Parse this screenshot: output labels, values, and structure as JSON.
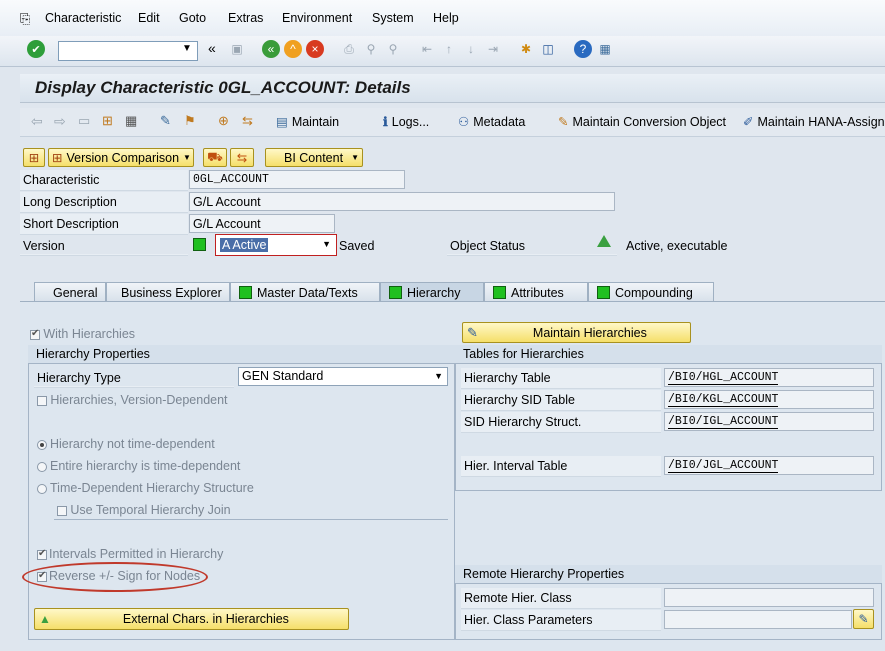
{
  "menu": {
    "items": [
      "Characteristic",
      "Edit",
      "Goto",
      "Extras",
      "Environment",
      "System",
      "Help"
    ]
  },
  "toolbar": {
    "command_field": ""
  },
  "title": "Display Characteristic 0GL_ACCOUNT: Details",
  "app_toolbar": {
    "maintain": "Maintain",
    "logs": "Logs...",
    "metadata": "Metadata",
    "maintain_conversion": "Maintain Conversion Object",
    "maintain_hana": "Maintain HANA-Assignm"
  },
  "header_buttons": {
    "version_comparison": "Version Comparison",
    "bi_content": "BI Content"
  },
  "fields": {
    "characteristic_label": "Characteristic",
    "characteristic_value": "0GL_ACCOUNT",
    "long_desc_label": "Long Description",
    "long_desc_value": "G/L Account",
    "short_desc_label": "Short Description",
    "short_desc_value": "G/L Account",
    "version_label": "Version",
    "version_value": "A Active",
    "version_status": "Saved",
    "object_status_label": "Object Status",
    "object_status_value": "Active, executable"
  },
  "tabs": [
    "General",
    "Business Explorer",
    "Master Data/Texts",
    "Hierarchy",
    "Attributes",
    "Compounding"
  ],
  "hierarchy": {
    "with_hierarchies": "With Hierarchies",
    "maintain_hierarchies": "Maintain Hierarchies",
    "props_title": "Hierarchy Properties",
    "hierarchy_type_label": "Hierarchy Type",
    "hierarchy_type_value": "GEN Standard",
    "version_dependent": "Hierarchies, Version-Dependent",
    "not_time_dependent": "Hierarchy not time-dependent",
    "entire_time_dependent": "Entire hierarchy is time-dependent",
    "time_dep_structure": "Time-Dependent Hierarchy Structure",
    "temporal_join": "Use Temporal Hierarchy Join",
    "intervals_permitted": "Intervals Permitted in Hierarchy",
    "reverse_sign": "Reverse +/- Sign for Nodes",
    "external_chars": "External Chars. in Hierarchies",
    "tables_title": "Tables for Hierarchies",
    "hier_table_label": "Hierarchy Table",
    "hier_table_value": "/BI0/HGL_ACCOUNT",
    "sid_table_label": "Hierarchy SID Table",
    "sid_table_value": "/BI0/KGL_ACCOUNT",
    "sid_struct_label": "SID Hierarchy Struct.",
    "sid_struct_value": "/BI0/IGL_ACCOUNT",
    "interval_table_label": "Hier. Interval Table",
    "interval_table_value": "/BI0/JGL_ACCOUNT",
    "remote_title": "Remote Hierarchy Properties",
    "remote_class_label": "Remote Hier. Class",
    "remote_class_value": "",
    "class_params_label": "Hier. Class Parameters",
    "class_params_value": ""
  },
  "colors": {
    "yellow_button": "#f5df6a",
    "green_status": "#20c020",
    "highlight": "#c0392b"
  }
}
